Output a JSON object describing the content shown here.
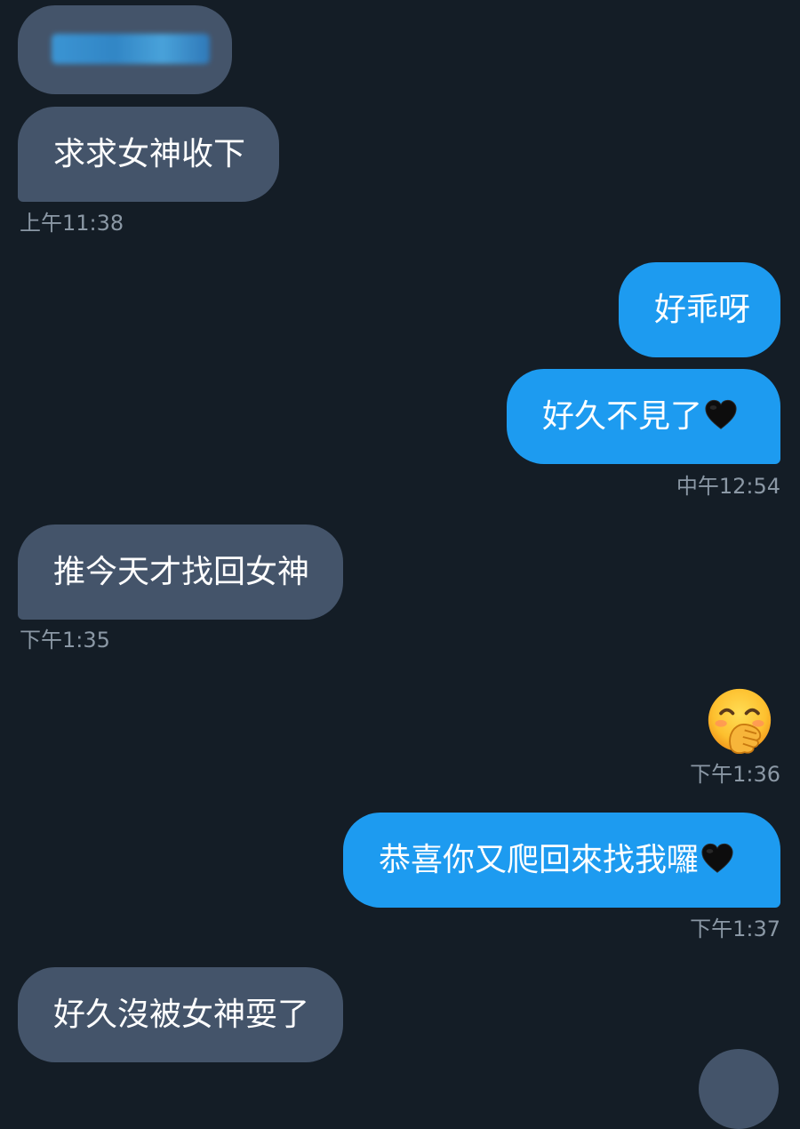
{
  "conversation": {
    "messages": [
      {
        "sender": "other",
        "text": "[redacted]",
        "redacted": true
      },
      {
        "sender": "other",
        "text": "求求女神收下",
        "time": "上午11:38"
      },
      {
        "sender": "me",
        "text": "好乖呀"
      },
      {
        "sender": "me",
        "text": "好久不見了",
        "emoji": "black-heart",
        "time": "中午12:54"
      },
      {
        "sender": "other",
        "text": "推今天才找回女神",
        "time": "下午1:35"
      },
      {
        "sender": "me",
        "text": "",
        "emoji": "face-with-hand-over-mouth",
        "time": "下午1:36"
      },
      {
        "sender": "me",
        "text": "恭喜你又爬回來找我囉",
        "emoji": "black-heart",
        "time": "下午1:37"
      },
      {
        "sender": "other",
        "text": "好久沒被女神耍了"
      }
    ]
  },
  "colors": {
    "background": "#141d26",
    "incoming_bubble": "#44546a",
    "outgoing_bubble": "#1d9bf0",
    "timestamp": "#8b98a5",
    "text": "#ffffff"
  }
}
